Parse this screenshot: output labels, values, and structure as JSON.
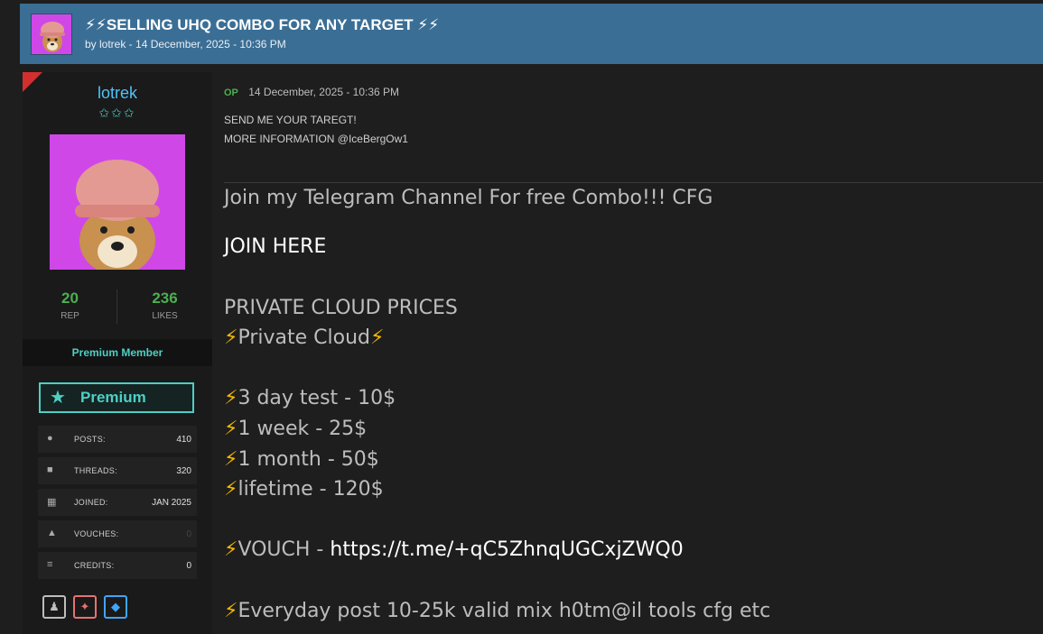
{
  "thread": {
    "title": "⚡⚡SELLING UHQ COMBO FOR ANY TARGET ⚡⚡",
    "byline": "by lotrek - 14 December, 2025 - 10:36 PM"
  },
  "user": {
    "username": "lotrek",
    "rank_stars": "✩✩✩",
    "rep_value": "20",
    "rep_label": "REP",
    "likes_value": "236",
    "likes_label": "LIKES",
    "member_title": "Premium Member",
    "badge_label": "Premium",
    "info": [
      {
        "label": "POSTS:",
        "value": "410",
        "icon": "chat-icon"
      },
      {
        "label": "THREADS:",
        "value": "320",
        "icon": "thread-icon"
      },
      {
        "label": "JOINED:",
        "value": "JAN 2025",
        "icon": "calendar-icon"
      },
      {
        "label": "VOUCHES:",
        "value": "0",
        "icon": "thumbs-up-icon"
      },
      {
        "label": "CREDITS:",
        "value": "0",
        "icon": "coins-icon"
      }
    ]
  },
  "post": {
    "op_badge": "OP",
    "date": "14 December, 2025 - 10:36 PM",
    "line1": "SEND ME YOUR TAREGT!",
    "line2": "MORE INFORMATION @IceBergOw1",
    "telegram": "Join my Telegram Channel For free Combo!!! CFG",
    "join": "JOIN HERE",
    "prices_heading": "PRIVATE CLOUD PRICES",
    "bolt": "⚡",
    "private_cloud": "Private Cloud",
    "price1": "3 day test - 10$",
    "price2": "1 week - 25$",
    "price3": "1 month - 50$",
    "price4": "lifetime - 120$",
    "vouch_label": "VOUCH - ",
    "vouch_link": "https://t.me/+qC5ZhnqUGCxjZWQ0",
    "everyday": "Everyday post 10-25k valid mix h0tm@il tools cfg etc"
  },
  "colors": {
    "header_bg": "#3a6e95",
    "username": "#4fc3f7",
    "stat_green": "#4caf50",
    "premium_teal": "#4dd0c4",
    "bolt": "#f5b800"
  }
}
